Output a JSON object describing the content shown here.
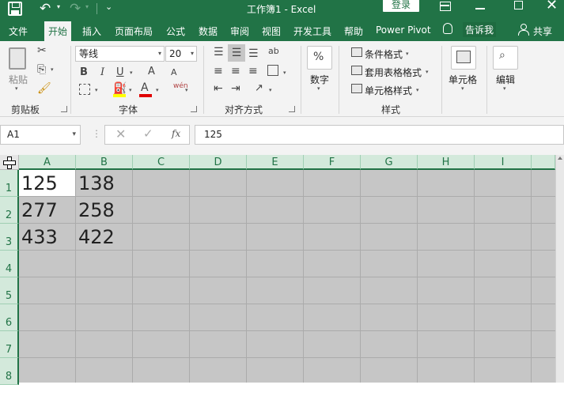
{
  "window": {
    "title": "工作簿1  -  Excel",
    "login_label": "登录"
  },
  "tabs": [
    {
      "label": "文件"
    },
    {
      "label": "开始"
    },
    {
      "label": "插入"
    },
    {
      "label": "页面布局"
    },
    {
      "label": "公式"
    },
    {
      "label": "数据"
    },
    {
      "label": "审阅"
    },
    {
      "label": "视图"
    },
    {
      "label": "开发工具"
    },
    {
      "label": "帮助"
    },
    {
      "label": "Power Pivot"
    }
  ],
  "active_tab": "开始",
  "tell_me": "告诉我",
  "share": "共享",
  "ribbon": {
    "clipboard": {
      "paste": "粘贴",
      "label": "剪贴板"
    },
    "font": {
      "name": "等线",
      "size": "20",
      "label": "字体",
      "bold": "B",
      "italic": "I",
      "underline": "U",
      "grow": "A",
      "shrink": "A",
      "wen": "wén",
      "color_a": "A"
    },
    "alignment": {
      "label": "对齐方式",
      "wrap": "ab"
    },
    "number": {
      "percent": "%",
      "label": "数字"
    },
    "styles": {
      "conditional": "条件格式",
      "table_format": "套用表格格式",
      "cell_style": "单元格样式",
      "label": "样式"
    },
    "cells": {
      "label": "单元格"
    },
    "editing": {
      "label": "编辑"
    }
  },
  "formula_bar": {
    "name_box": "A1",
    "fx": "fx",
    "value": "125"
  },
  "sheet": {
    "columns": [
      "A",
      "B",
      "C",
      "D",
      "E",
      "F",
      "G",
      "H",
      "I"
    ],
    "rows": [
      "1",
      "2",
      "3",
      "4",
      "5",
      "6",
      "7",
      "8"
    ],
    "cells": [
      [
        "125",
        "138"
      ],
      [
        "277",
        "258"
      ],
      [
        "433",
        "422"
      ]
    ],
    "active_cell": "A1"
  },
  "colors": {
    "accent": "#217346",
    "grid_fill": "#c6c6c6",
    "header_highlight": "#d3e9db"
  }
}
